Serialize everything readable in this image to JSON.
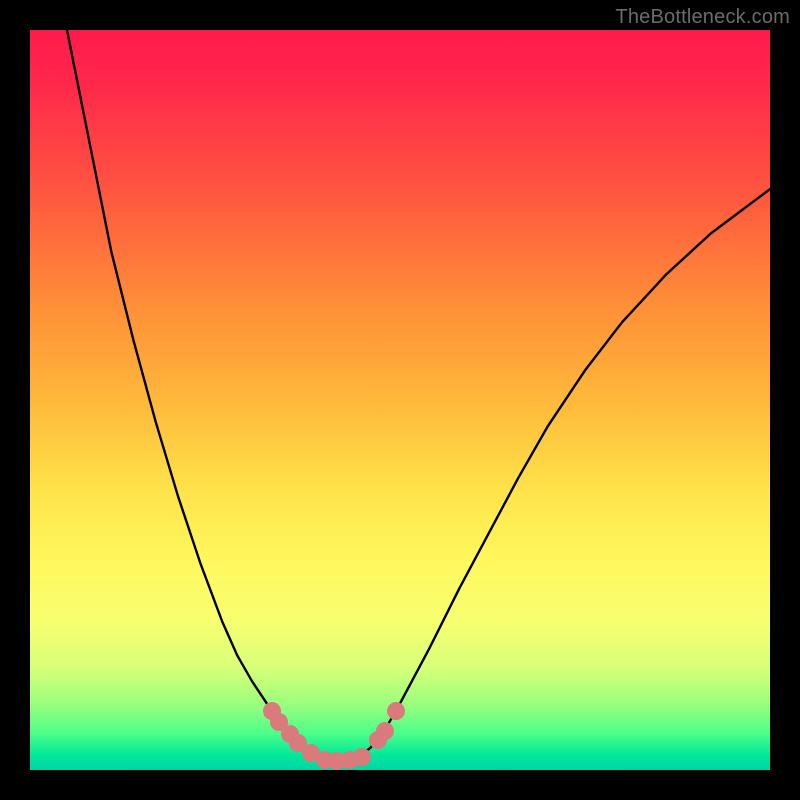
{
  "watermark": "TheBottleneck.com",
  "chart_data": {
    "type": "line",
    "title": "",
    "xlabel": "",
    "ylabel": "",
    "xlim": [
      0,
      1
    ],
    "ylim": [
      0,
      1
    ],
    "series": [
      {
        "name": "curve",
        "x": [
          0.05,
          0.07,
          0.09,
          0.11,
          0.14,
          0.17,
          0.2,
          0.23,
          0.26,
          0.28,
          0.3,
          0.32,
          0.33,
          0.345,
          0.36,
          0.38,
          0.4,
          0.42,
          0.44,
          0.46,
          0.48,
          0.5,
          0.54,
          0.58,
          0.62,
          0.66,
          0.7,
          0.75,
          0.8,
          0.86,
          0.92,
          0.98,
          1.0
        ],
        "y": [
          1.0,
          0.9,
          0.8,
          0.7,
          0.58,
          0.47,
          0.37,
          0.28,
          0.2,
          0.155,
          0.12,
          0.09,
          0.075,
          0.055,
          0.04,
          0.023,
          0.012,
          0.012,
          0.015,
          0.03,
          0.055,
          0.09,
          0.165,
          0.245,
          0.32,
          0.395,
          0.465,
          0.54,
          0.605,
          0.67,
          0.725,
          0.77,
          0.785
        ]
      }
    ],
    "markers": [
      {
        "x": 0.327,
        "y": 0.08
      },
      {
        "x": 0.337,
        "y": 0.065
      },
      {
        "x": 0.352,
        "y": 0.048
      },
      {
        "x": 0.362,
        "y": 0.037
      },
      {
        "x": 0.38,
        "y": 0.023
      },
      {
        "x": 0.398,
        "y": 0.013
      },
      {
        "x": 0.415,
        "y": 0.012
      },
      {
        "x": 0.432,
        "y": 0.013
      },
      {
        "x": 0.448,
        "y": 0.018
      },
      {
        "x": 0.47,
        "y": 0.04
      },
      {
        "x": 0.48,
        "y": 0.053
      },
      {
        "x": 0.495,
        "y": 0.08
      }
    ],
    "gradient_stops": [
      {
        "pos": 0.0,
        "color": "#ff1a4d"
      },
      {
        "pos": 0.5,
        "color": "#ffb83a"
      },
      {
        "pos": 0.8,
        "color": "#f7ff70"
      },
      {
        "pos": 1.0,
        "color": "#00d4a6"
      }
    ]
  }
}
